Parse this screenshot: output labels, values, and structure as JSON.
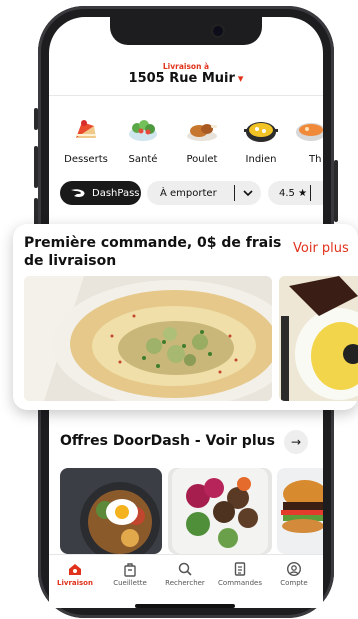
{
  "header": {
    "delivery_label": "Livraison à",
    "address": "1505 Rue Muir",
    "chevron": "▾"
  },
  "categories": [
    {
      "label": "Desserts",
      "icon": "cake-icon"
    },
    {
      "label": "Santé",
      "icon": "salad-icon"
    },
    {
      "label": "Poulet",
      "icon": "chicken-icon"
    },
    {
      "label": "Indien",
      "icon": "curry-icon"
    },
    {
      "label": "Th",
      "icon": "thai-icon"
    }
  ],
  "filters": {
    "dashpass": "DashPass",
    "pickup": "À emporter",
    "rating": "4.5 ★"
  },
  "promo": {
    "title": "Première commande, 0$ de frais de livraison",
    "link": "Voir plus"
  },
  "offers": {
    "title": "Offres DoorDash - Voir plus",
    "arrow": "→"
  },
  "tabs": [
    {
      "label": "Livraison",
      "icon": "home-icon",
      "active": true
    },
    {
      "label": "Cueillette",
      "icon": "bag-icon",
      "active": false
    },
    {
      "label": "Rechercher",
      "icon": "search-icon",
      "active": false
    },
    {
      "label": "Commandes",
      "icon": "orders-icon",
      "active": false
    },
    {
      "label": "Compte",
      "icon": "account-icon",
      "active": false
    }
  ],
  "colors": {
    "brand": "#e0311b",
    "dark": "#191919"
  }
}
